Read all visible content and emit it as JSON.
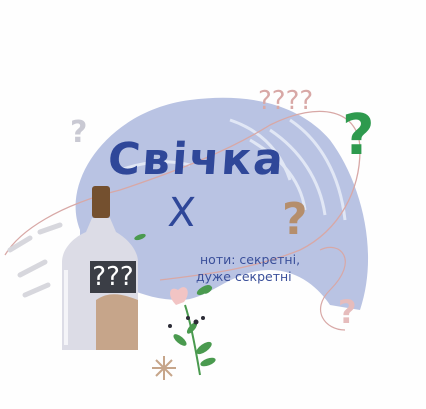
{
  "title": {
    "line1": "Свічка",
    "line2": "Х"
  },
  "subtitle": {
    "line1": "ноти: секретні,",
    "line2": "дуже секретні"
  },
  "bottle_label": "???",
  "decorations": {
    "question_marks": [
      {
        "text": "?",
        "color": "#c9c9d3"
      },
      {
        "text": "?",
        "color": "#2e9a4e"
      },
      {
        "text": "?",
        "color": "#b58e6c"
      },
      {
        "text": "?",
        "color": "#d8a8a6"
      },
      {
        "text": "????",
        "color": "#d8a8a6"
      }
    ],
    "colors": {
      "blob": "#b9c3e3",
      "title": "#2f4799",
      "bottle_glass": "#dcdce6",
      "bottle_amber": "#c6a58a",
      "bottle_cap": "#74502f",
      "leaf": "#4a9a4f",
      "flower": "#f2c4c4"
    }
  }
}
